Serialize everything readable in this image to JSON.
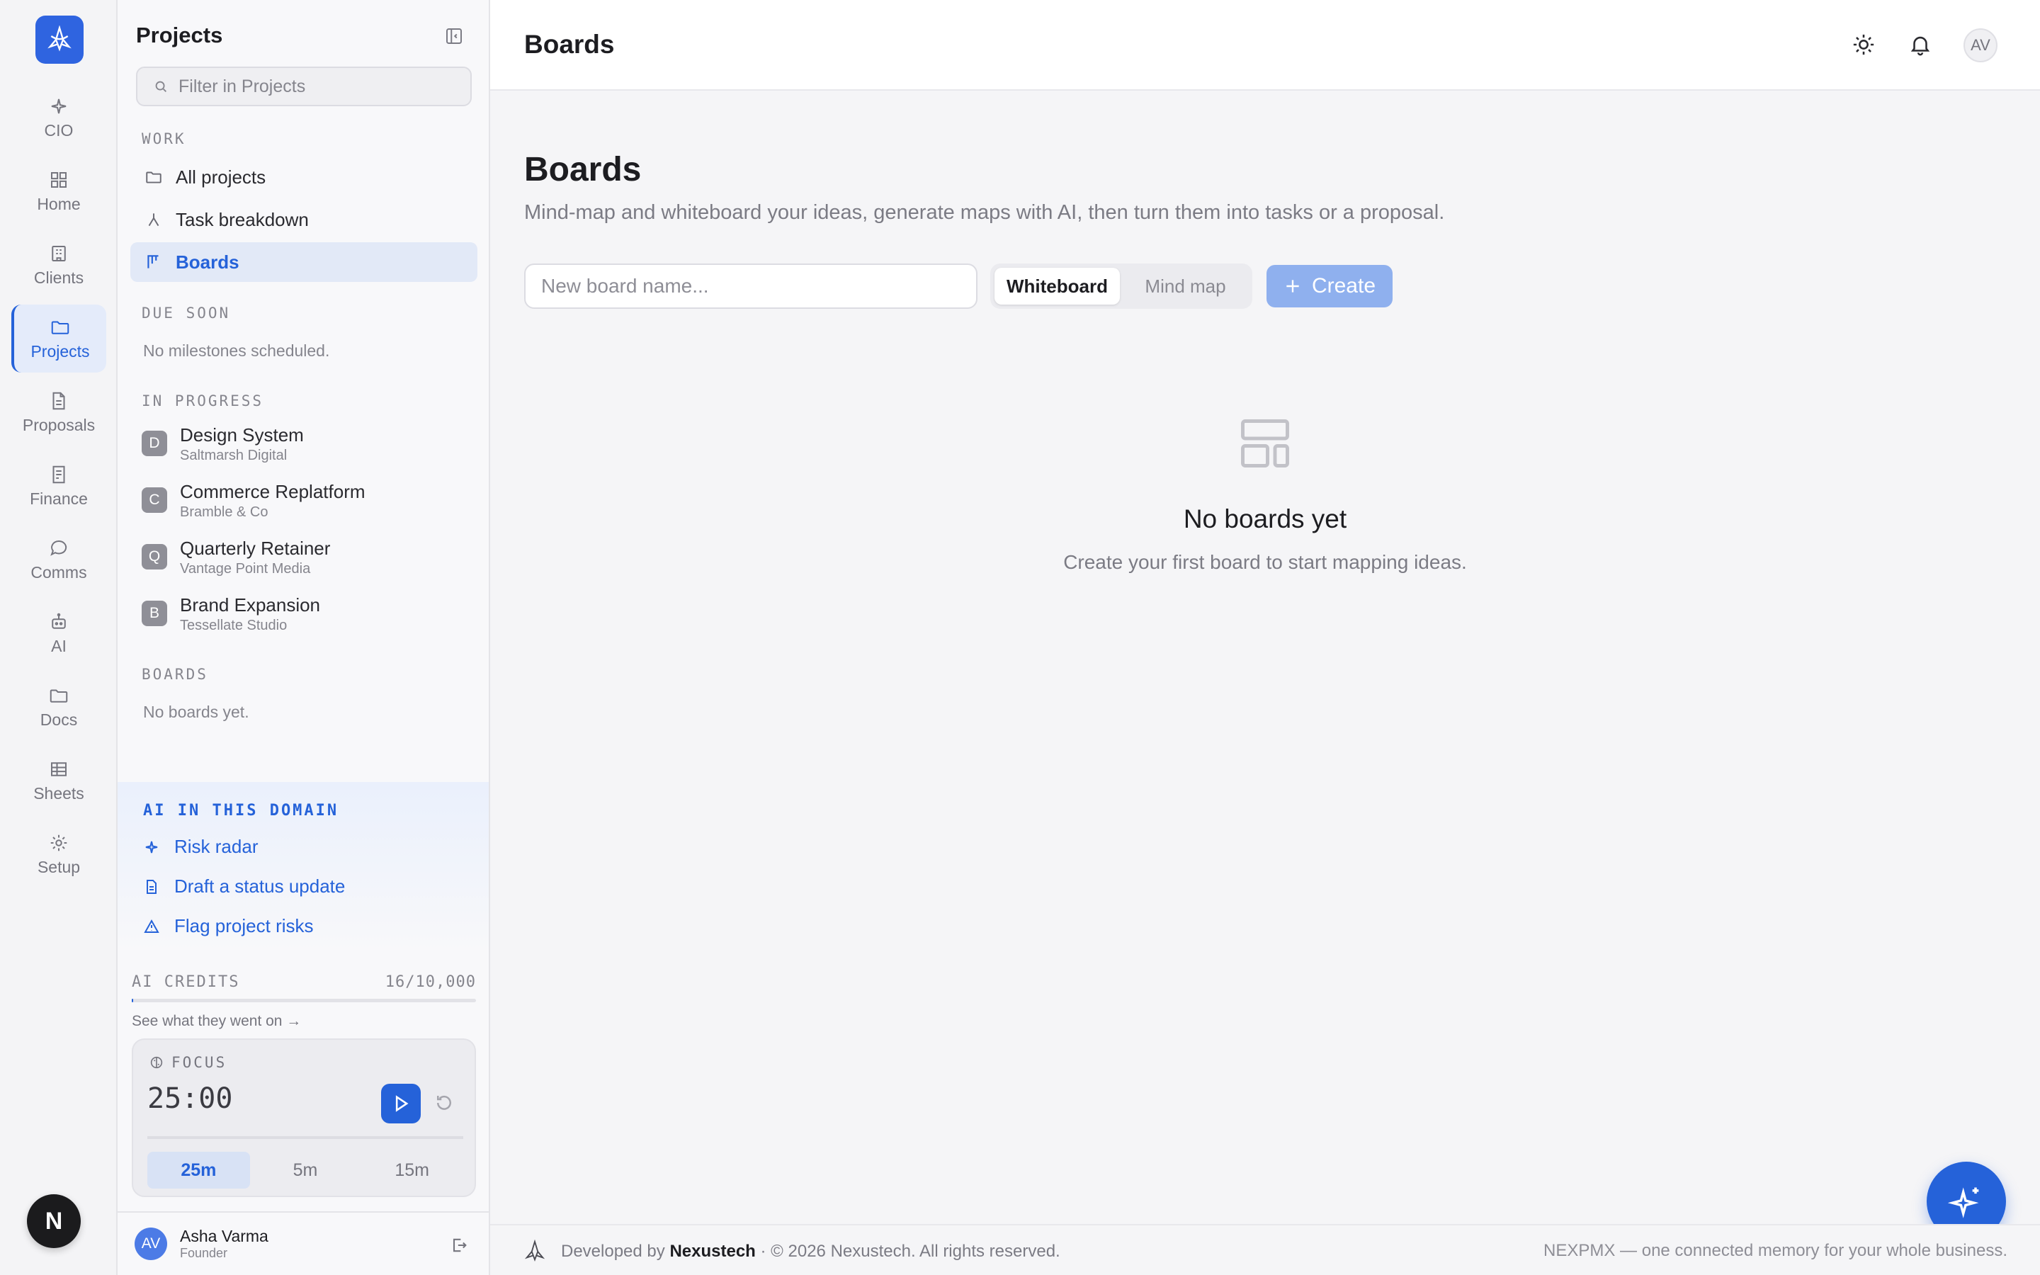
{
  "rail": {
    "items": [
      {
        "label": "CIO",
        "icon": "sparkle-icon"
      },
      {
        "label": "Home",
        "icon": "grid-icon"
      },
      {
        "label": "Clients",
        "icon": "building-icon"
      },
      {
        "label": "Projects",
        "icon": "folder-icon",
        "active": true
      },
      {
        "label": "Proposals",
        "icon": "document-icon"
      },
      {
        "label": "Finance",
        "icon": "receipt-icon"
      },
      {
        "label": "Comms",
        "icon": "chat-icon"
      },
      {
        "label": "AI",
        "icon": "robot-icon"
      },
      {
        "label": "Docs",
        "icon": "folder-icon"
      },
      {
        "label": "Sheets",
        "icon": "table-icon"
      },
      {
        "label": "Setup",
        "icon": "gear-icon"
      }
    ],
    "bottom_badge": "N"
  },
  "sidebar": {
    "title": "Projects",
    "search_placeholder": "Filter in Projects",
    "work_label": "WORK",
    "work_items": [
      {
        "label": "All projects",
        "icon": "folder-icon"
      },
      {
        "label": "Task breakdown",
        "icon": "branch-icon"
      },
      {
        "label": "Boards",
        "icon": "kanban-icon",
        "active": true
      }
    ],
    "due_soon_label": "DUE SOON",
    "due_soon_empty": "No milestones scheduled.",
    "in_progress_label": "IN PROGRESS",
    "projects": [
      {
        "initial": "D",
        "name": "Design System",
        "client": "Saltmarsh Digital"
      },
      {
        "initial": "C",
        "name": "Commerce Replatform",
        "client": "Bramble & Co"
      },
      {
        "initial": "Q",
        "name": "Quarterly Retainer",
        "client": "Vantage Point Media"
      },
      {
        "initial": "B",
        "name": "Brand Expansion",
        "client": "Tessellate Studio"
      }
    ],
    "boards_label": "BOARDS",
    "boards_empty": "No boards yet.",
    "ai": {
      "title": "AI IN THIS DOMAIN",
      "links": [
        {
          "label": "Risk radar",
          "icon": "sparkle-icon"
        },
        {
          "label": "Draft a status update",
          "icon": "document-icon"
        },
        {
          "label": "Flag project risks",
          "icon": "warning-icon"
        }
      ]
    },
    "credits": {
      "label": "AI CREDITS",
      "value": "16/10,000",
      "used_fraction": 0.0016,
      "link": "See what they went on →"
    },
    "focus": {
      "label": "FOCUS",
      "time": "25:00",
      "presets": [
        "25m",
        "5m",
        "15m"
      ],
      "active_preset": "25m"
    },
    "user": {
      "initials": "AV",
      "name": "Asha Varma",
      "role": "Founder"
    }
  },
  "topbar": {
    "title": "Boards",
    "avatar": "AV"
  },
  "main": {
    "heading": "Boards",
    "subtitle": "Mind-map and whiteboard your ideas, generate maps with AI, then turn them into tasks or a proposal.",
    "input_placeholder": "New board name...",
    "modes": [
      "Whiteboard",
      "Mind map"
    ],
    "active_mode": "Whiteboard",
    "create_label": "Create",
    "empty_title": "No boards yet",
    "empty_sub": "Create your first board to start mapping ideas."
  },
  "footer": {
    "developed_by": "Developed by",
    "company": "Nexustech",
    "copyright": "· © 2026 Nexustech. All rights reserved.",
    "tagline": "NEXPMX — one connected memory for your whole business."
  },
  "colors": {
    "accent": "#2562d9",
    "accent_light": "#8fb0ee",
    "active_bg": "#e2e9f7"
  }
}
